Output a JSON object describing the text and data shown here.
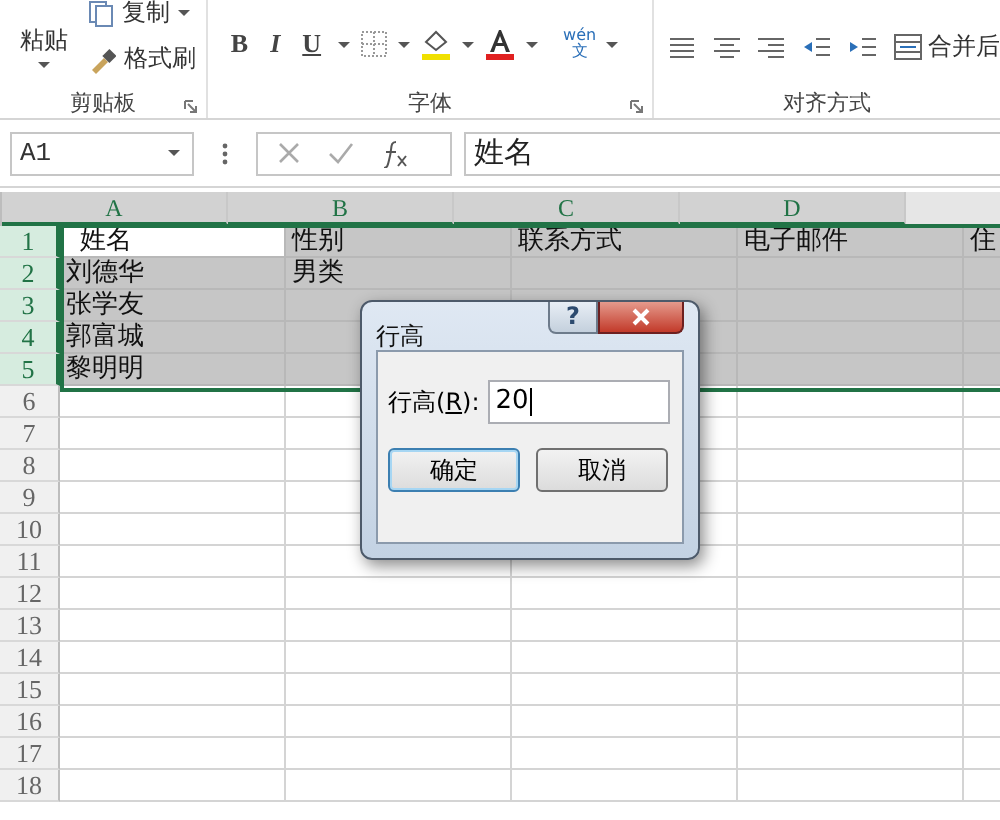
{
  "ribbon": {
    "groups": [
      {
        "kind": "clipboard",
        "label": "剪贴板",
        "paste": "粘贴",
        "copy": "复制",
        "format_painter": "格式刷"
      },
      {
        "kind": "font",
        "label": "字体",
        "bold": "B",
        "italic": "I",
        "underline": "U",
        "phonetic": [
          "wén",
          "文"
        ]
      },
      {
        "kind": "alignment",
        "label": "对齐方式",
        "merge": "合并后"
      }
    ]
  },
  "formula_bar": {
    "name_box": "A1",
    "formula": "姓名"
  },
  "sheet": {
    "columns": [
      {
        "label": "A",
        "selected": true
      },
      {
        "label": "B",
        "selected": true
      },
      {
        "label": "C",
        "selected": true
      },
      {
        "label": "D",
        "selected": true
      }
    ],
    "rows": [
      {
        "header": "1",
        "selected": true,
        "cells": [
          {
            "text": "姓名",
            "active": true
          },
          {
            "text": "性别",
            "active": false
          },
          {
            "text": "联系方式",
            "active": false
          },
          {
            "text": "电子邮件",
            "active": false
          },
          {
            "text": "住",
            "active": false
          }
        ]
      },
      {
        "header": "2",
        "selected": true,
        "cells": [
          {
            "text": "刘德华",
            "active": false
          },
          {
            "text": "男类",
            "active": false
          }
        ]
      },
      {
        "header": "3",
        "selected": true,
        "cells": [
          {
            "text": "张学友",
            "active": false
          }
        ]
      },
      {
        "header": "4",
        "selected": true,
        "cells": [
          {
            "text": "郭富城",
            "active": false
          }
        ]
      },
      {
        "header": "5",
        "selected": true,
        "cells": [
          {
            "text": "黎明明",
            "active": false
          }
        ]
      },
      {
        "header": "6",
        "selected": false
      },
      {
        "header": "7",
        "selected": false
      },
      {
        "header": "8",
        "selected": false
      },
      {
        "header": "9",
        "selected": false
      },
      {
        "header": "10",
        "selected": false
      },
      {
        "header": "11",
        "selected": false
      },
      {
        "header": "12",
        "selected": false
      },
      {
        "header": "13",
        "selected": false
      },
      {
        "header": "14",
        "selected": false
      },
      {
        "header": "15",
        "selected": false
      },
      {
        "header": "16",
        "selected": false
      },
      {
        "header": "17",
        "selected": false
      },
      {
        "header": "18",
        "selected": false
      }
    ]
  },
  "dialog": {
    "title": "行高",
    "help": "?",
    "label_parts": [
      {
        "text": "行高(",
        "underline": false
      },
      {
        "text": "R",
        "underline": true
      },
      {
        "text": "):",
        "underline": false
      }
    ],
    "value": "20",
    "buttons": [
      {
        "label": "确定",
        "default": true
      },
      {
        "label": "取消",
        "default": false
      }
    ]
  }
}
